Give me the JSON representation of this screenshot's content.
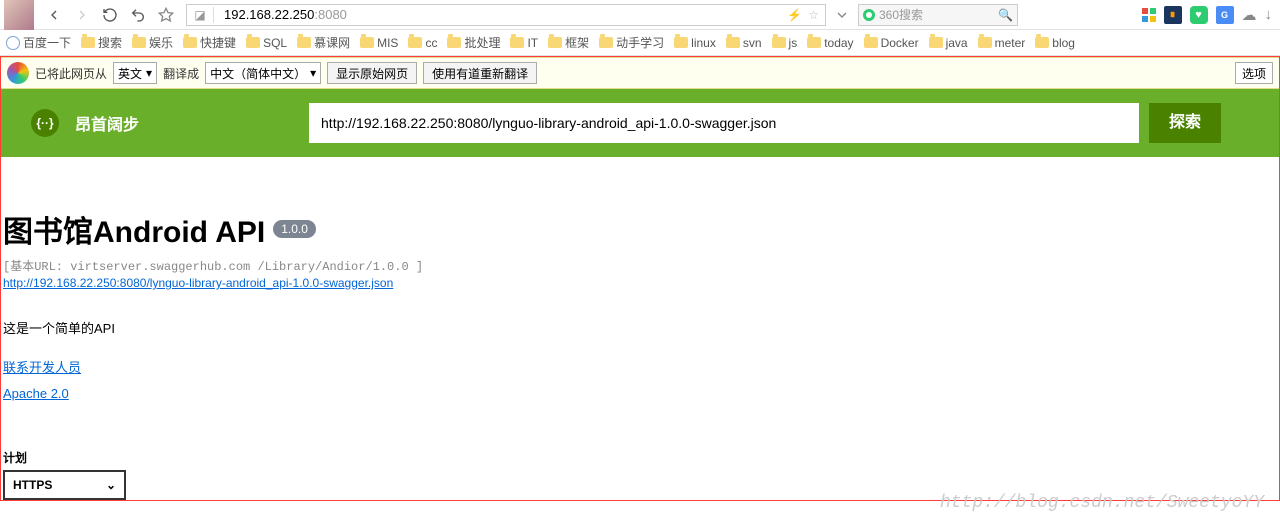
{
  "chrome": {
    "url_host": "192.168.22.250",
    "url_port": ":8080",
    "search_placeholder": "360搜索"
  },
  "bookmarks": {
    "first": "百度一下",
    "items": [
      "搜索",
      "娱乐",
      "快捷键",
      "SQL",
      "慕课网",
      "MIS",
      "cc",
      "批处理",
      "IT",
      "框架",
      "动手学习",
      "linux",
      "svn",
      "js",
      "today",
      "Docker",
      "java",
      "meter",
      "blog"
    ]
  },
  "translate": {
    "prefix": "已将此网页从",
    "from_lang": "英文",
    "to_label": "翻译成",
    "to_lang": "中文（简体中文）",
    "show_original": "显示原始网页",
    "retranslate": "使用有道重新翻译",
    "options": "选项"
  },
  "swagger": {
    "logo_text": "{··}",
    "brand": "昂首阔步",
    "input_value": "http://192.168.22.250:8080/lynguo-library-android_api-1.0.0-swagger.json",
    "explore": "探索"
  },
  "info": {
    "title": "图书馆Android API",
    "version": "1.0.0",
    "base_url": "[基本URL: virtserver.swaggerhub.com /Library/Andior/1.0.0 ]",
    "spec_link": "http://192.168.22.250:8080/lynguo-library-android_api-1.0.0-swagger.json",
    "description": "这是一个简单的API",
    "contact": "联系开发人员",
    "license": "Apache 2.0"
  },
  "schemes": {
    "label": "计划",
    "value": "HTTPS"
  },
  "watermark": "http://blog.csdn.net/SweetyoYY"
}
